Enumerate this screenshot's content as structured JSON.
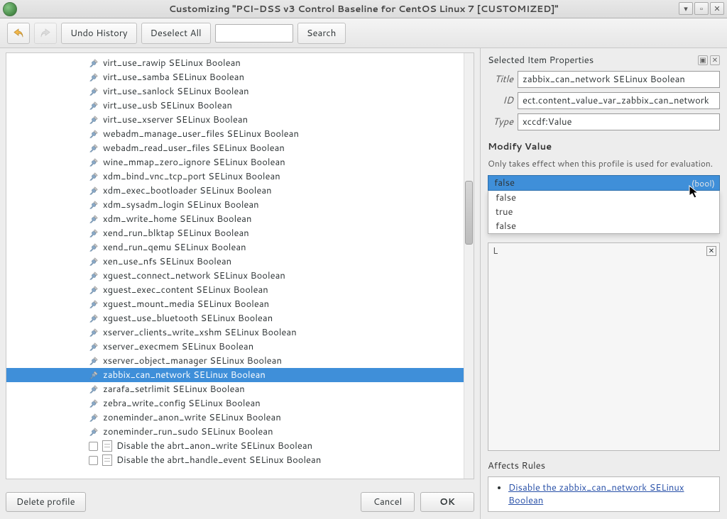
{
  "window": {
    "title": "Customizing \"PCI-DSS v3 Control Baseline for CentOS Linux 7 [CUSTOMIZED]\""
  },
  "toolbar": {
    "undo_history": "Undo History",
    "deselect_all": "Deselect All",
    "search_btn": "Search",
    "search_value": ""
  },
  "tree_items": [
    {
      "kind": "tool",
      "label": "virt_use_rawip SELinux Boolean"
    },
    {
      "kind": "tool",
      "label": "virt_use_samba SELinux Boolean"
    },
    {
      "kind": "tool",
      "label": "virt_use_sanlock SELinux Boolean"
    },
    {
      "kind": "tool",
      "label": "virt_use_usb SELinux Boolean"
    },
    {
      "kind": "tool",
      "label": "virt_use_xserver SELinux Boolean"
    },
    {
      "kind": "tool",
      "label": "webadm_manage_user_files SELinux Boolean"
    },
    {
      "kind": "tool",
      "label": "webadm_read_user_files SELinux Boolean"
    },
    {
      "kind": "tool",
      "label": "wine_mmap_zero_ignore SELinux Boolean"
    },
    {
      "kind": "tool",
      "label": "xdm_bind_vnc_tcp_port SELinux Boolean"
    },
    {
      "kind": "tool",
      "label": "xdm_exec_bootloader SELinux Boolean"
    },
    {
      "kind": "tool",
      "label": "xdm_sysadm_login SELinux Boolean"
    },
    {
      "kind": "tool",
      "label": "xdm_write_home SELinux Boolean"
    },
    {
      "kind": "tool",
      "label": "xend_run_blktap SELinux Boolean"
    },
    {
      "kind": "tool",
      "label": "xend_run_qemu SELinux Boolean"
    },
    {
      "kind": "tool",
      "label": "xen_use_nfs SELinux Boolean"
    },
    {
      "kind": "tool",
      "label": "xguest_connect_network SELinux Boolean"
    },
    {
      "kind": "tool",
      "label": "xguest_exec_content SELinux Boolean"
    },
    {
      "kind": "tool",
      "label": "xguest_mount_media SELinux Boolean"
    },
    {
      "kind": "tool",
      "label": "xguest_use_bluetooth SELinux Boolean"
    },
    {
      "kind": "tool",
      "label": "xserver_clients_write_xshm SELinux Boolean"
    },
    {
      "kind": "tool",
      "label": "xserver_execmem SELinux Boolean"
    },
    {
      "kind": "tool",
      "label": "xserver_object_manager SELinux Boolean"
    },
    {
      "kind": "tool",
      "label": "zabbix_can_network SELinux Boolean",
      "selected": true
    },
    {
      "kind": "tool",
      "label": "zarafa_setrlimit SELinux Boolean"
    },
    {
      "kind": "tool",
      "label": "zebra_write_config SELinux Boolean"
    },
    {
      "kind": "tool",
      "label": "zoneminder_anon_write SELinux Boolean"
    },
    {
      "kind": "tool",
      "label": "zoneminder_run_sudo SELinux Boolean"
    },
    {
      "kind": "rule",
      "label": "Disable the abrt_anon_write SELinux Boolean"
    },
    {
      "kind": "rule",
      "label": "Disable the abrt_handle_event SELinux Boolean"
    }
  ],
  "buttons": {
    "delete_profile": "Delete profile",
    "cancel": "Cancel",
    "ok": "OK"
  },
  "props": {
    "header": "Selected Item Properties",
    "title_label": "Title",
    "title_value": "zabbix_can_network SELinux Boolean",
    "id_label": "ID",
    "id_value": "ect.content_value_var_zabbix_can_network",
    "type_label": "Type",
    "type_value": "xccdf:Value",
    "modify_label": "Modify Value",
    "modify_hint": "Only takes effect when this profile is used for evaluation.",
    "dropdown": {
      "selected": "false",
      "type_tag": "(bool)",
      "options": [
        "false",
        "true",
        "false"
      ]
    },
    "affects_label": "Affects Rules",
    "affects_link": "Disable the zabbix_can_network SELinux Boolean"
  }
}
